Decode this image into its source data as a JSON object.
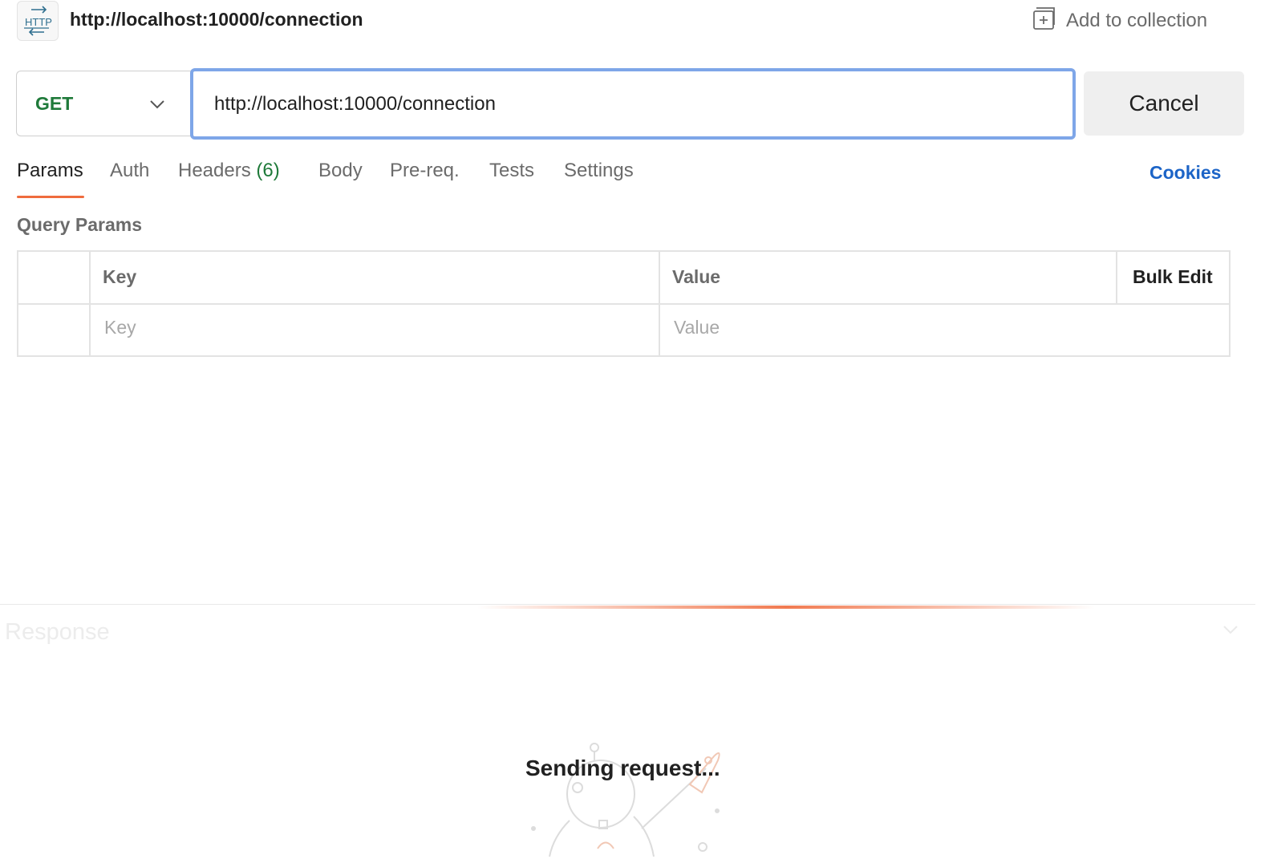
{
  "header": {
    "title": "http://localhost:10000/connection",
    "badge_text": "HTTP",
    "add_to_collection": "Add to collection",
    "icons": [
      "http-request-icon",
      "add-to-collection-icon"
    ]
  },
  "request": {
    "method": "GET",
    "method_color": "#1f7a3a",
    "url": "http://localhost:10000/connection",
    "cancel_label": "Cancel"
  },
  "tabs": {
    "items": [
      {
        "label": "Params",
        "active": true
      },
      {
        "label": "Auth"
      },
      {
        "label": "Headers",
        "count": "(6)"
      },
      {
        "label": "Body"
      },
      {
        "label": "Pre-req."
      },
      {
        "label": "Tests"
      },
      {
        "label": "Settings"
      }
    ],
    "cookies": "Cookies",
    "accent_color": "#ef6c3e",
    "link_color": "#1c64c7"
  },
  "query_params": {
    "title": "Query Params",
    "headers": {
      "key": "Key",
      "value": "Value",
      "bulk_edit": "Bulk Edit"
    },
    "placeholders": {
      "key": "Key",
      "value": "Value"
    }
  },
  "response": {
    "title": "Response",
    "status": "Sending request..."
  }
}
